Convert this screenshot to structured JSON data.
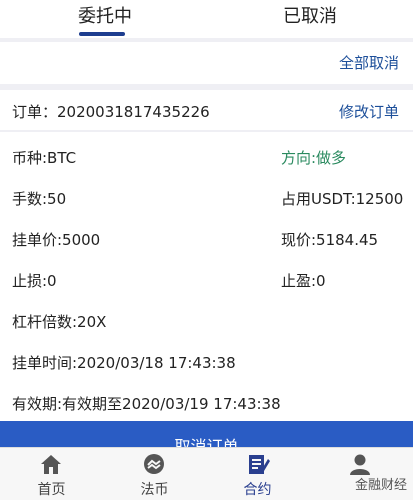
{
  "tabs": {
    "active": "委托中",
    "inactive": "已取消"
  },
  "actions": {
    "cancel_all": "全部取消",
    "modify_order": "修改订单",
    "cancel_order": "取消订单"
  },
  "order": {
    "label": "订单：2020031817435226"
  },
  "fields": {
    "currency": "币种:BTC",
    "direction": "方向:做多",
    "lots": "手数:50",
    "margin": "占用USDT:12500",
    "order_price": "挂单价:5000",
    "current_price": "现价:5184.45",
    "stop_loss": "止损:0",
    "take_profit": "止盈:0",
    "leverage": "杠杆倍数:20X",
    "order_time": "挂单时间:2020/03/18 17:43:38",
    "validity": "有效期:有效期至2020/03/19 17:43:38"
  },
  "nav": {
    "items": [
      {
        "label": "首页",
        "icon": "home-icon"
      },
      {
        "label": "法币",
        "icon": "exchange-icon"
      },
      {
        "label": "合约",
        "icon": "contract-icon"
      },
      {
        "label": "",
        "icon": "user-icon"
      }
    ]
  },
  "watermark": "金融财经",
  "colors": {
    "accent_blue": "#1d4f9a",
    "button_blue": "#2a5cc4",
    "direction_green": "#2a8a5f",
    "underline": "#1d3d8f"
  }
}
